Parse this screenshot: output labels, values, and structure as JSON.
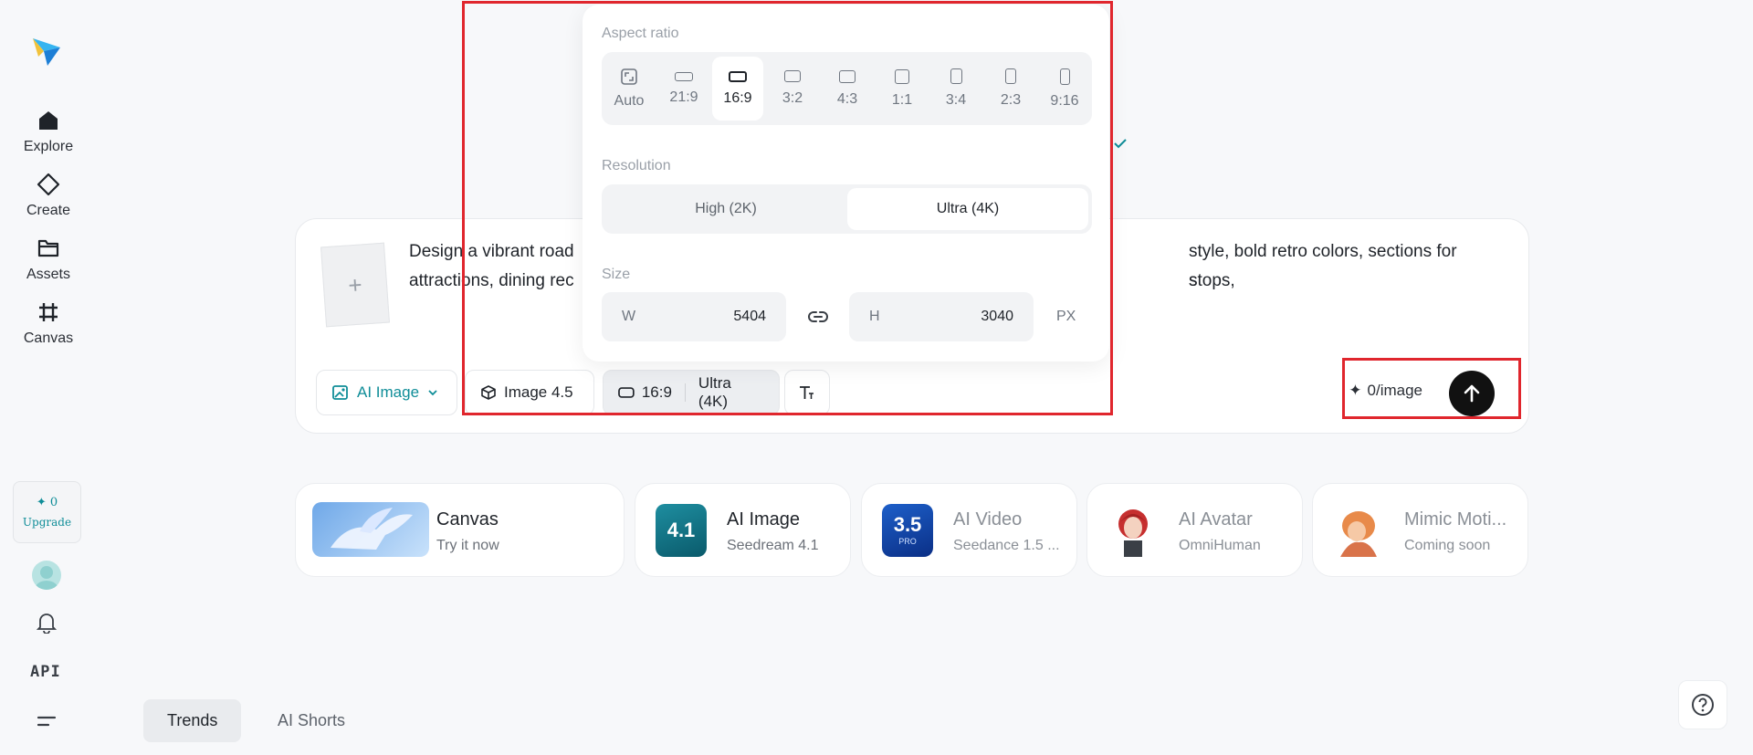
{
  "sidebar": {
    "nav": [
      {
        "label": "Explore",
        "icon": "home-icon"
      },
      {
        "label": "Create",
        "icon": "diamond-icon"
      },
      {
        "label": "Assets",
        "icon": "folder-icon"
      },
      {
        "label": "Canvas",
        "icon": "frame-icon"
      }
    ],
    "credits": "0",
    "upgrade": "Upgrade",
    "api": "API"
  },
  "prompt": {
    "text_line1_a": "Design a vibrant road",
    "text_line1_b": "style, bold retro colors, sections for stops,",
    "text_line2_a": "attractions, dining rec",
    "text_line2_b": "s",
    "add_symbol": "+"
  },
  "toolbar": {
    "mode": "AI Image",
    "model": "Image 4.5",
    "ratio": "16:9",
    "resolution": "Ultra (4K)",
    "cost": "0/image"
  },
  "popup": {
    "aspect_label": "Aspect ratio",
    "ratios": [
      "Auto",
      "21:9",
      "16:9",
      "3:2",
      "4:3",
      "1:1",
      "3:4",
      "2:3",
      "9:16"
    ],
    "selected_ratio": "16:9",
    "resolution_label": "Resolution",
    "resolution_options": [
      "High (2K)",
      "Ultra (4K)"
    ],
    "selected_resolution": "Ultra (4K)",
    "size_label": "Size",
    "width_key": "W",
    "width_value": "5404",
    "height_key": "H",
    "height_value": "3040",
    "unit": "PX"
  },
  "features": [
    {
      "title": "Canvas",
      "subtitle": "Try it now"
    },
    {
      "title": "AI Image",
      "subtitle": "Seedream 4.1",
      "badge": "4.1"
    },
    {
      "title": "AI Video",
      "subtitle": "Seedance 1.5 ...",
      "badge": "3.5",
      "badge_sub": "PRO"
    },
    {
      "title": "AI Avatar",
      "subtitle": "OmniHuman"
    },
    {
      "title": "Mimic Moti...",
      "subtitle": "Coming soon"
    }
  ],
  "tabs": [
    {
      "label": "Trends",
      "active": true
    },
    {
      "label": "AI Shorts",
      "active": false
    }
  ],
  "colors": {
    "accent": "#0f8d98",
    "highlight": "#e0262d"
  }
}
